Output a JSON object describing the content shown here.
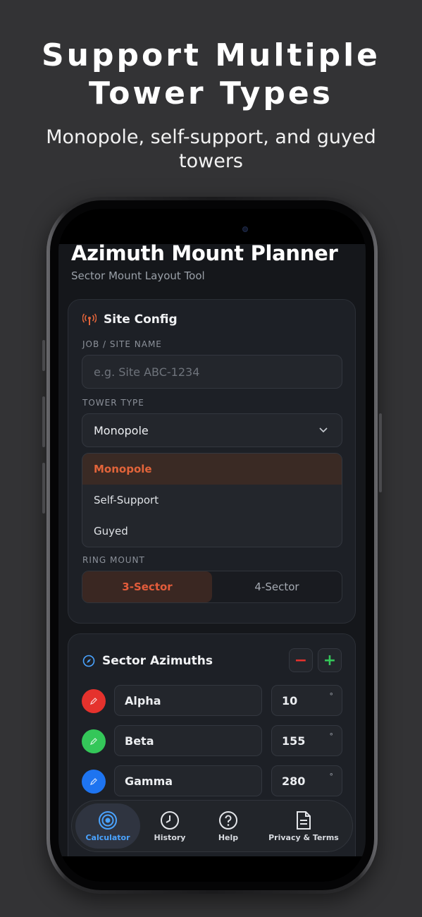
{
  "promo": {
    "title_line1": "Support Multiple",
    "title_line2": "Tower Types",
    "subtitle": "Monopole, self-support, and guyed towers"
  },
  "app": {
    "title": "Azimuth Mount Planner",
    "subtitle": "Sector Mount Layout Tool"
  },
  "site_config": {
    "heading": "Site Config",
    "job_label": "JOB / SITE NAME",
    "job_placeholder": "e.g. Site ABC-1234",
    "tower_label": "TOWER TYPE",
    "tower_selected": "Monopole",
    "tower_options": [
      "Monopole",
      "Self-Support",
      "Guyed"
    ],
    "ring_label": "RING MOUNT",
    "ring_options": [
      "3-Sector",
      "4-Sector"
    ],
    "ring_selected": "3-Sector"
  },
  "sectors": {
    "heading": "Sector Azimuths",
    "minus": "−",
    "plus": "+",
    "unit": "°",
    "items": [
      {
        "name": "Alpha",
        "azimuth": "10",
        "color": "#e5322d"
      },
      {
        "name": "Beta",
        "azimuth": "155",
        "color": "#34c759"
      },
      {
        "name": "Gamma",
        "azimuth": "280",
        "color": "#1e74f0"
      }
    ]
  },
  "tabs": [
    {
      "label": "Calculator",
      "icon": "target-icon",
      "active": true
    },
    {
      "label": "History",
      "icon": "clock-icon",
      "active": false
    },
    {
      "label": "Help",
      "icon": "question-icon",
      "active": false
    },
    {
      "label": "Privacy & Terms",
      "icon": "document-icon",
      "active": false
    }
  ],
  "colors": {
    "accent_orange": "#e35c3b",
    "accent_blue": "#4aa3ff",
    "minus_red": "#e5322d",
    "plus_green": "#34c759"
  }
}
